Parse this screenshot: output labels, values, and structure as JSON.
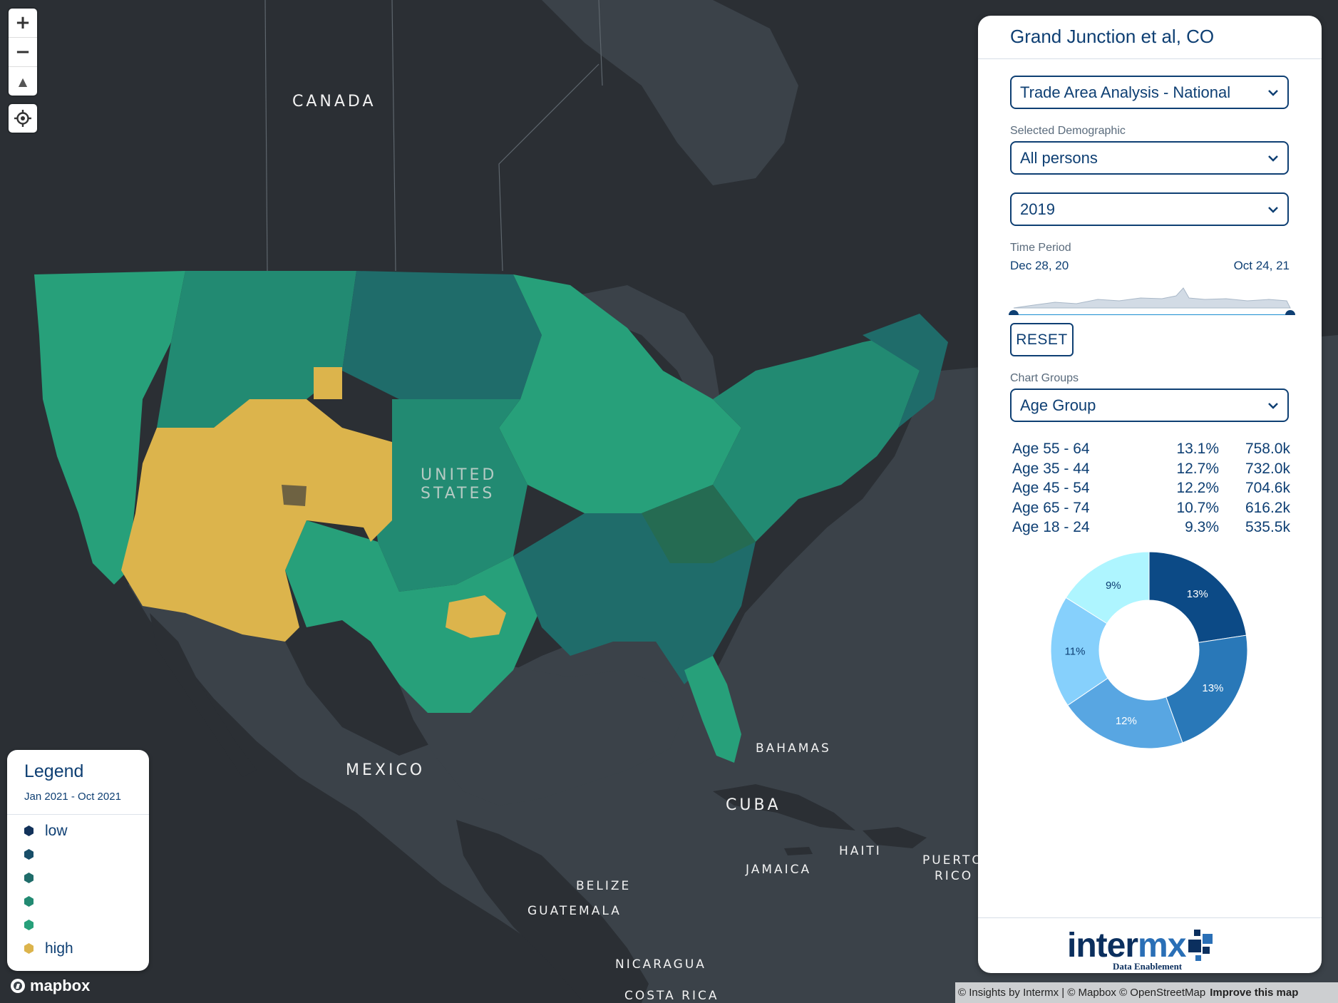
{
  "map": {
    "controls": {
      "zoom_in_label": "+",
      "zoom_out_label": "−",
      "compass_label": "▲"
    },
    "labels": {
      "canada": "CANADA",
      "united": "UNITED",
      "states": "STATES",
      "mexico": "MEXICO",
      "bahamas": "BAHAMAS",
      "cuba": "CUBA",
      "haiti": "HAITI",
      "puerto": "PUERTO",
      "rico": "RICO",
      "jamaica": "JAMAICA",
      "belize": "BELIZE",
      "guatemala": "GUATEMALA",
      "nicaragua": "NICARAGUA",
      "costa_rica": "COSTA RICA"
    },
    "colors": {
      "water": "#3b4249",
      "land": "#2a2e33",
      "high": "#d8b24e",
      "mid_high": "#2a9a72",
      "mid": "#24805f",
      "mid_low": "#256b52",
      "low": "#2b5446"
    },
    "mapbox_logo": "mapbox",
    "attribution": "© Insights by Intermx | © Mapbox © OpenStreetMap",
    "improve_link": "Improve this map"
  },
  "legend": {
    "title": "Legend",
    "range": "Jan 2021 - Oct 2021",
    "items": [
      {
        "label": "low",
        "color": "#12325a"
      },
      {
        "label": "",
        "color": "#184e68"
      },
      {
        "label": "",
        "color": "#1f6c6a"
      },
      {
        "label": "",
        "color": "#228a72"
      },
      {
        "label": "",
        "color": "#27a07a"
      },
      {
        "label": "high",
        "color": "#dcb44c"
      }
    ]
  },
  "panel": {
    "title": "Grand Junction et al, CO",
    "analysis_select": "Trade Area Analysis - National",
    "demographic_label": "Selected Demographic",
    "demographic_select": "All persons",
    "year_select": "2019",
    "time_period_label": "Time Period",
    "date_start": "Dec 28, 20",
    "date_end": "Oct 24, 21",
    "reset_label": "RESET",
    "chart_groups_label": "Chart Groups",
    "chart_groups_select": "Age Group",
    "age_rows": [
      {
        "group": "Age 55 - 64",
        "pct": "13.1%",
        "count": "758.0k"
      },
      {
        "group": "Age 35 - 44",
        "pct": "12.7%",
        "count": "732.0k"
      },
      {
        "group": "Age 45 - 54",
        "pct": "12.2%",
        "count": "704.6k"
      },
      {
        "group": "Age 65 - 74",
        "pct": "10.7%",
        "count": "616.2k"
      },
      {
        "group": "Age 18 - 24",
        "pct": "9.3%",
        "count": "535.5k"
      }
    ],
    "donut": [
      {
        "label": "13%",
        "value": 13.1,
        "color": "#0c4a86",
        "text": "#ffffff"
      },
      {
        "label": "13%",
        "value": 12.7,
        "color": "#2978b8",
        "text": "#ffffff"
      },
      {
        "label": "12%",
        "value": 12.2,
        "color": "#58a6e2",
        "text": "#ffffff"
      },
      {
        "label": "11%",
        "value": 10.7,
        "color": "#86d0fc",
        "text": "#0e3f73"
      },
      {
        "label": "9%",
        "value": 9.3,
        "color": "#aef5ff",
        "text": "#0e3f73"
      }
    ],
    "brand_inter": "inter",
    "brand_mx": "mx",
    "brand_tagline": "Data Enablement"
  }
}
